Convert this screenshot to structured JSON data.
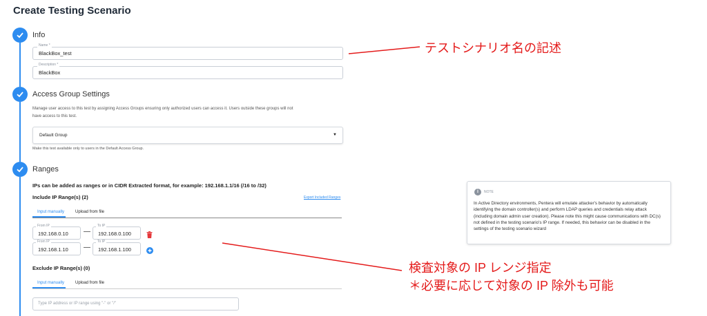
{
  "page": {
    "title": "Create Testing Scenario"
  },
  "info": {
    "title": "Info",
    "name_label": "Name *",
    "name_value": "BlackBox_test",
    "description_label": "Description *",
    "description_value": "BlackBox"
  },
  "access": {
    "title": "Access Group Settings",
    "description_line1": "Manage user access to this test by assigning Access Groups ensuring only authorized users can access it. Users outside these groups will not",
    "description_line2": "have access to this test.",
    "selected_group": "Default Group",
    "helper": "Make this test available only to users in the Default Access Group."
  },
  "ranges": {
    "title": "Ranges",
    "hint": "IPs can be added as ranges or in CIDR Extracted format, for example: 192.168.1.1/16 (/16 to /32)",
    "include_title": "Include IP Range(s) (2)",
    "export_link": "Export Included Ranges",
    "tab_manual": "Input manually",
    "tab_file": "Upload from file",
    "from_label": "From IP",
    "to_label": "To IP",
    "rows": [
      {
        "from": "192.168.0.10",
        "to": "192.168.0.100"
      },
      {
        "from": "192.168.1.10",
        "to": "192.168.1.100"
      }
    ],
    "exclude_title": "Exclude IP Range(s) (0)",
    "exclude_tab_manual": "Input manually",
    "exclude_tab_file": "Upload from file",
    "exclude_placeholder": "Type IP address or IP range using \"-\" or \"/\""
  },
  "note": {
    "title": "NOTE",
    "text": "In Active Directory environments, Pentera will emulate attacker's behavior by automatically identifying the domain controller(s) and perform LDAP queries and credentials relay attack (including domain admin user creation). Please note this might cause communications with DC(s) not defined in the testing scenario's IP range. If needed, this behavior can be disabled in the settings of the testing scenario wizard"
  },
  "annotations": {
    "name_note": "テストシナリオ名の記述",
    "ip_note_line1": "検査対象の IP レンジ指定",
    "ip_note_line2": "＊必要に応じて対象の IP 除外も可能"
  },
  "colors": {
    "accent": "#2d8cf0",
    "annotation": "#e41a1a",
    "delete": "#e5383b"
  }
}
